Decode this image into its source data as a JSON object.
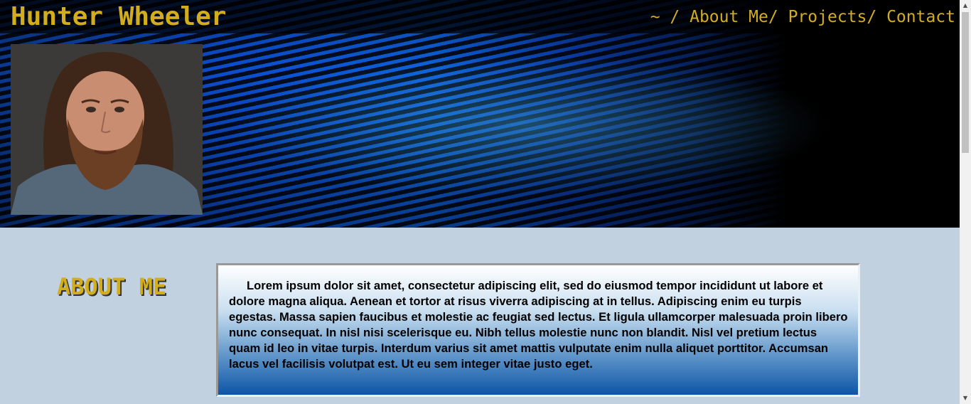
{
  "header": {
    "title": "Hunter Wheeler",
    "nav": [
      {
        "label": "~ / "
      },
      {
        "label": "About Me"
      },
      {
        "label": "/ "
      },
      {
        "label": "Projects"
      },
      {
        "label": "/ "
      },
      {
        "label": "Contact"
      }
    ],
    "accent_color": "#d2ad1e"
  },
  "about": {
    "heading": "ABOUT ME",
    "text": "Lorem ipsum dolor sit amet, consectetur adipiscing elit, sed do eiusmod tempor incididunt ut labore et dolore magna aliqua. Aenean et tortor at risus viverra adipiscing at in tellus. Adipiscing enim eu turpis egestas. Massa sapien faucibus et molestie ac feugiat sed lectus. Et ligula ullamcorper malesuada proin libero nunc consequat. In nisl nisi scelerisque eu. Nibh tellus molestie nunc non blandit. Nisl vel pretium lectus quam id leo in vitae turpis. Interdum varius sit amet mattis vulputate enim nulla aliquet porttitor. Accumsan lacus vel facilisis volutpat est. Ut eu sem integer vitae justo eget."
  },
  "scrollbar": {
    "up_icon": "▲",
    "down_icon": "▼"
  }
}
